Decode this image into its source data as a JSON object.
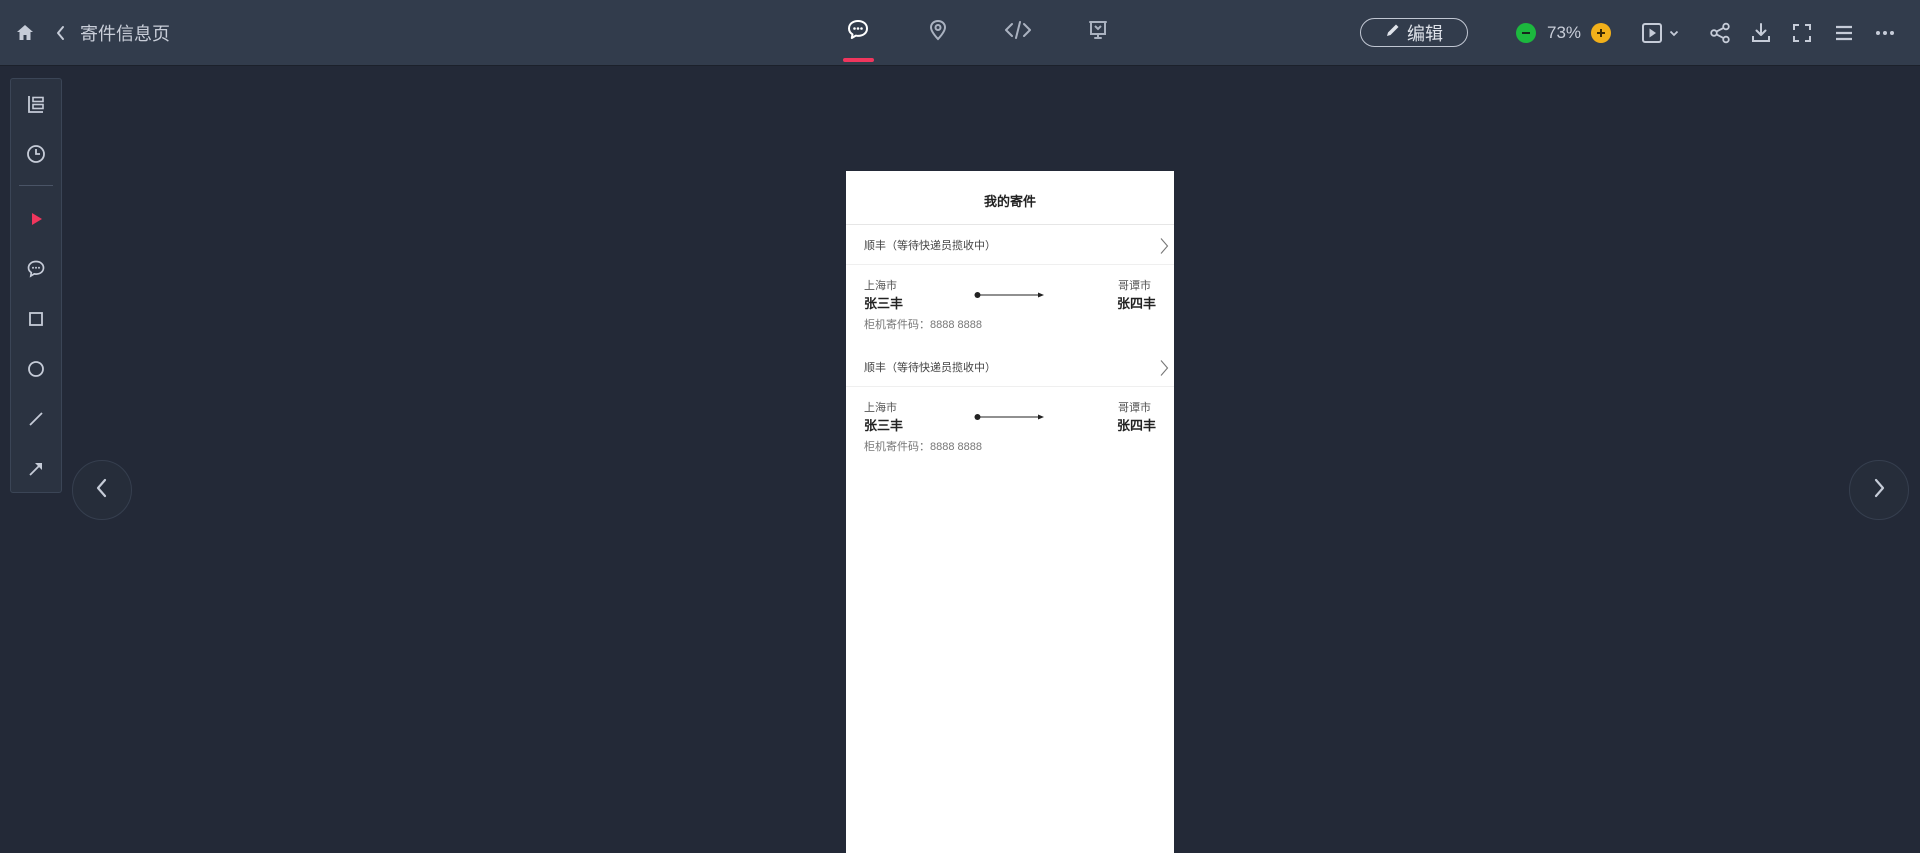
{
  "app": {
    "page_title": "寄件信息页",
    "edit_label": "编辑",
    "zoom": "73%"
  },
  "icons": {
    "top_left": [
      "home-icon",
      "back-icon"
    ],
    "top_tabs": [
      "comment-icon",
      "location-icon",
      "code-icon",
      "presentation-icon"
    ],
    "top_right": [
      "zoom-out-icon",
      "zoom-in-icon",
      "play-icon",
      "dropdown-icon",
      "share-icon",
      "download-icon",
      "fullscreen-icon",
      "menu-icon",
      "more-icon"
    ],
    "left_tools": [
      "pages-tree-icon",
      "history-icon",
      "pointer-icon",
      "comment-tool-icon",
      "rectangle-icon",
      "circle-icon",
      "line-icon",
      "arrow-tool-icon"
    ]
  },
  "colors": {
    "accent": "#f0365d",
    "zoom_out": "#1cb83e",
    "zoom_in": "#f2b01a",
    "canvas_bg": "#232937",
    "toolbar_bg": "#323c4c"
  },
  "phone": {
    "title": "我的寄件",
    "shipments": [
      {
        "status": "顺丰（等待快递员揽收中）",
        "from_city": "上海市",
        "from_name": "张三丰",
        "to_city": "哥谭市",
        "to_name": "张四丰",
        "code": "柜机寄件码：8888 8888"
      },
      {
        "status": "顺丰（等待快递员揽收中）",
        "from_city": "上海市",
        "from_name": "张三丰",
        "to_city": "哥谭市",
        "to_name": "张四丰",
        "code": "柜机寄件码：8888 8888"
      }
    ]
  }
}
